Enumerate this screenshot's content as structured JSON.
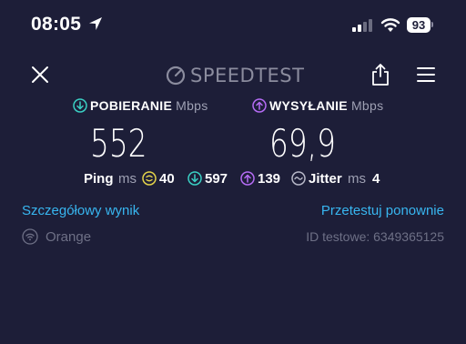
{
  "status_bar": {
    "time": "08:05",
    "battery": "93"
  },
  "header": {
    "logo": "SPEEDTEST"
  },
  "download": {
    "label": "POBIERANIE",
    "unit": "Mbps",
    "value": "552"
  },
  "upload": {
    "label": "WYSYŁANIE",
    "unit": "Mbps",
    "value": "69,9"
  },
  "ping": {
    "label": "Ping",
    "unit": "ms",
    "idle": "40",
    "download": "597",
    "upload": "139",
    "jitter_label": "Jitter",
    "jitter_unit": "ms",
    "jitter": "4"
  },
  "links": {
    "detail": "Szczegółowy wynik",
    "retest": "Przetestuj ponownie"
  },
  "provider": {
    "name": "Orange",
    "test_id": "ID testowe: 6349365125"
  },
  "colors": {
    "background": "#1d1e38",
    "download": "#3ad0c4",
    "upload": "#b56cf5",
    "link": "#38b6f0",
    "idle_ping": "#e4d34a"
  }
}
